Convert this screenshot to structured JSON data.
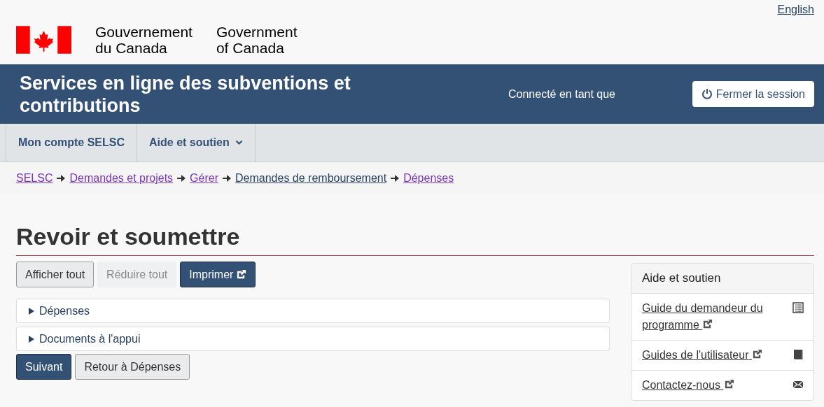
{
  "language_link": "English",
  "signature": {
    "french": [
      "Gouvernement",
      "du Canada"
    ],
    "english": [
      "Government",
      "of Canada"
    ]
  },
  "app_bar": {
    "title": "Services en ligne des subventions et contributions",
    "signed_in": "Connecté en tant que",
    "sign_out": "Fermer la session"
  },
  "menu": [
    {
      "label": "Mon compte SELSC",
      "dropdown": false
    },
    {
      "label": "Aide et soutien",
      "dropdown": true
    }
  ],
  "breadcrumbs": [
    {
      "label": "SELSC",
      "visited": true
    },
    {
      "label": "Demandes et projets",
      "visited": true
    },
    {
      "label": "Gérer",
      "visited": true
    },
    {
      "label": "Demandes de remboursement",
      "visited": false
    },
    {
      "label": "Dépenses",
      "visited": true
    }
  ],
  "heading": "Revoir et soumettre",
  "toolbar": [
    {
      "label": "Afficher tout",
      "kind": "default",
      "disabled": false,
      "external": false
    },
    {
      "label": "Réduire tout",
      "kind": "default",
      "disabled": true,
      "external": false
    },
    {
      "label": "Imprimer",
      "kind": "primary",
      "disabled": false,
      "external": true
    }
  ],
  "sections": [
    {
      "label": "Dépenses",
      "expanded": false
    },
    {
      "label": "Documents à l'appui",
      "expanded": false
    }
  ],
  "actions": [
    {
      "label": "Suivant",
      "kind": "primary"
    },
    {
      "label": "Retour à Dépenses",
      "kind": "default"
    }
  ],
  "help_panel": {
    "title": "Aide et soutien",
    "links": [
      {
        "label": "Guide du demandeur du programme",
        "kind": "list"
      },
      {
        "label": "Guides de l'utilisateur",
        "kind": "book"
      },
      {
        "label": "Contactez-nous",
        "kind": "envelope"
      }
    ]
  }
}
